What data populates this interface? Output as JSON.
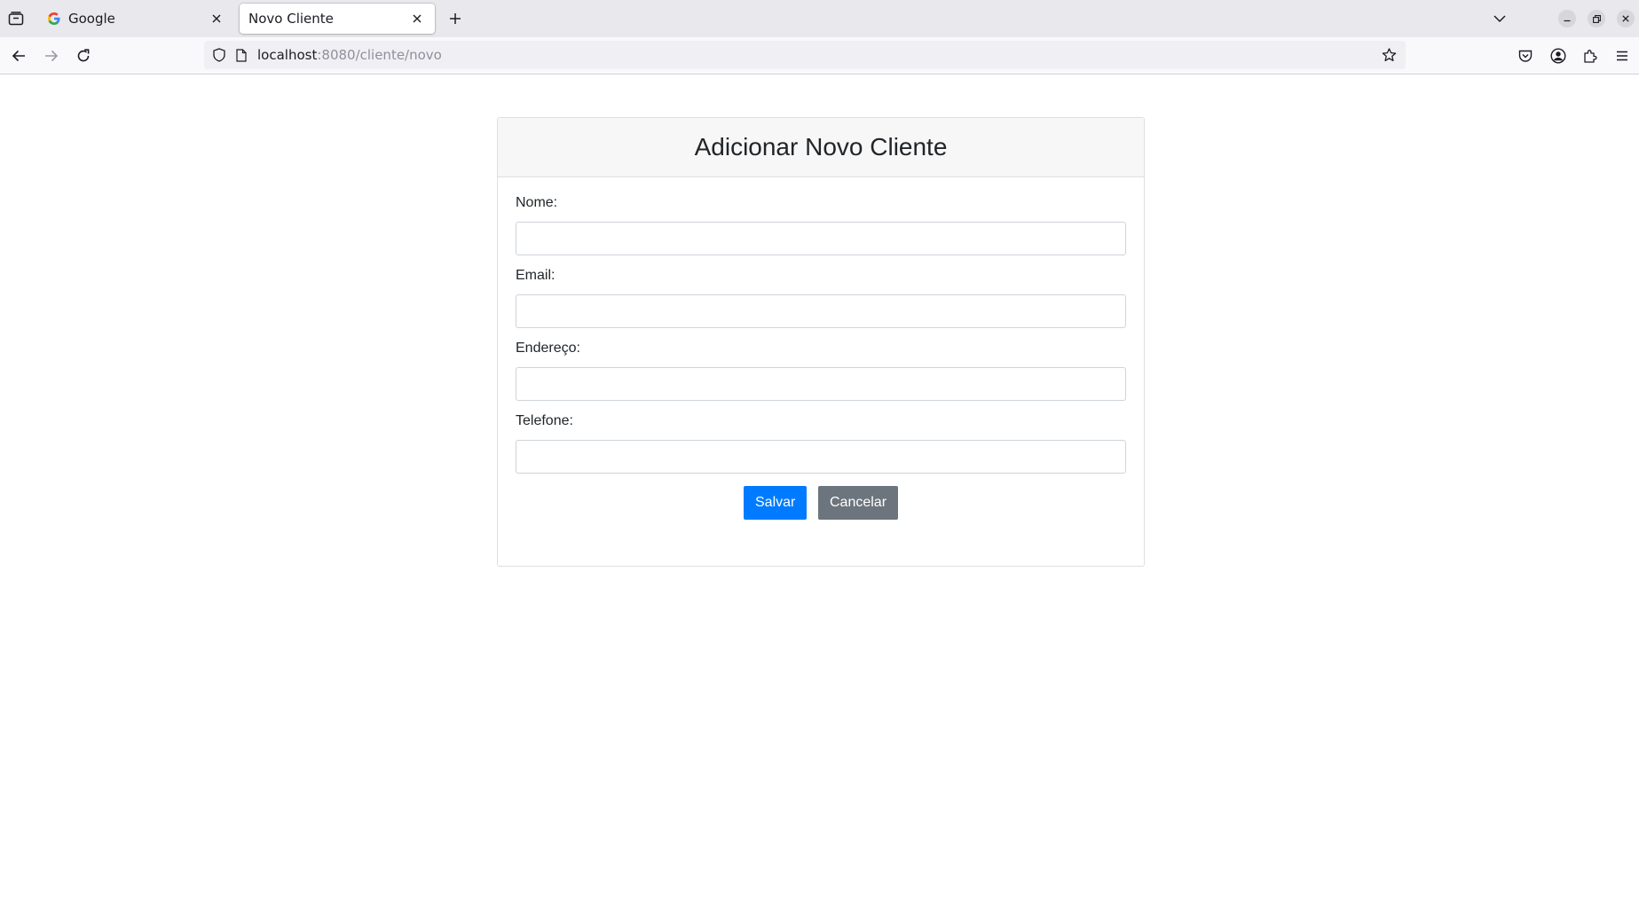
{
  "browser": {
    "tabs": [
      {
        "label": "Google",
        "active": false,
        "favicon": "google-g-icon"
      },
      {
        "label": "Novo Cliente",
        "active": true
      }
    ],
    "url": {
      "host": "localhost",
      "path": ":8080/cliente/novo"
    }
  },
  "form": {
    "title": "Adicionar Novo Cliente",
    "fields": [
      {
        "label": "Nome:",
        "value": ""
      },
      {
        "label": "Email:",
        "value": ""
      },
      {
        "label": "Endereço:",
        "value": ""
      },
      {
        "label": "Telefone:",
        "value": ""
      }
    ],
    "save_label": "Salvar",
    "cancel_label": "Cancelar"
  },
  "colors": {
    "primary": "#007bff",
    "secondary": "#6c757d"
  }
}
